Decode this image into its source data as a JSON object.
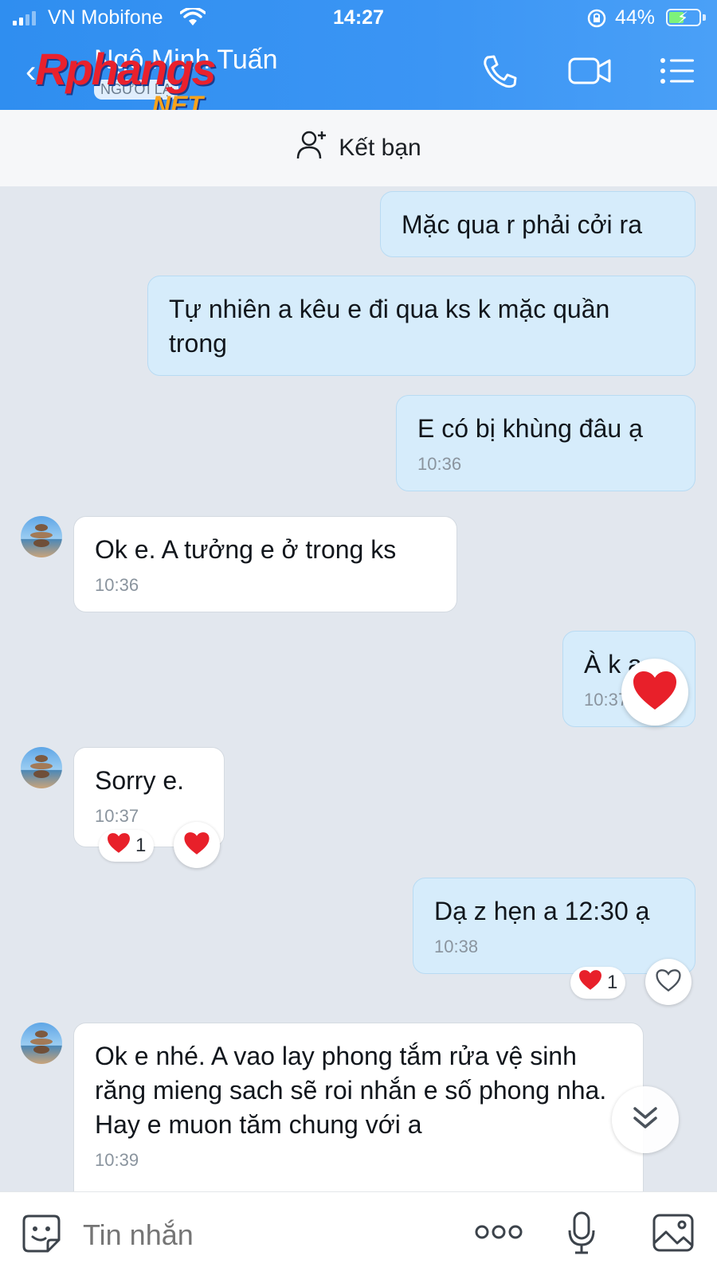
{
  "status_bar": {
    "carrier": "VN Mobifone",
    "time": "14:27",
    "battery": "44%"
  },
  "header": {
    "contact_name": "Ngô Minh Tuấn",
    "badge": "NGƯỜI LẠ",
    "watermark_main": "Rphangs",
    "watermark_suffix": ".NET",
    "icons": [
      "back-icon",
      "phone-icon",
      "video-icon",
      "menu-icon"
    ]
  },
  "add_friend": {
    "label": "Kết bạn",
    "icon": "add-user-icon"
  },
  "messages": [
    {
      "direction": "sent",
      "text": "Mặc qua r phải cởi ra"
    },
    {
      "direction": "sent",
      "text": "Tự nhiên a kêu e đi qua ks k mặc quần trong"
    },
    {
      "direction": "sent",
      "text": "E có bị khùng đâu ạ",
      "time": "10:36"
    },
    {
      "direction": "received",
      "text": "Ok e. A tưởng e ở trong ks",
      "time": "10:36"
    },
    {
      "direction": "sent",
      "text": "À k ạ",
      "time": "10:37"
    },
    {
      "direction": "received",
      "text": "Sorry e.",
      "time": "10:37",
      "reaction_count": "1"
    },
    {
      "direction": "sent",
      "text": "Dạ z hẹn a 12:30 ạ",
      "time": "10:38",
      "reaction_count": "1"
    },
    {
      "direction": "received",
      "text": "Ok e nhé. A vao lay phong tắm rửa vệ sinh răng mieng sach sẽ roi nhắn e số phong nha. Hay e muon tăm chung với a",
      "time": "10:39"
    }
  ],
  "input_bar": {
    "placeholder": "Tin nhắn",
    "icons": [
      "sticker-icon",
      "more-icon",
      "mic-icon",
      "image-icon"
    ]
  },
  "colors": {
    "header_blue": "#3b95f4",
    "sent_bubble": "#d6ecfb",
    "received_bubble": "#ffffff",
    "chat_background": "#e2e7ee",
    "heart_red": "#e8202a"
  }
}
